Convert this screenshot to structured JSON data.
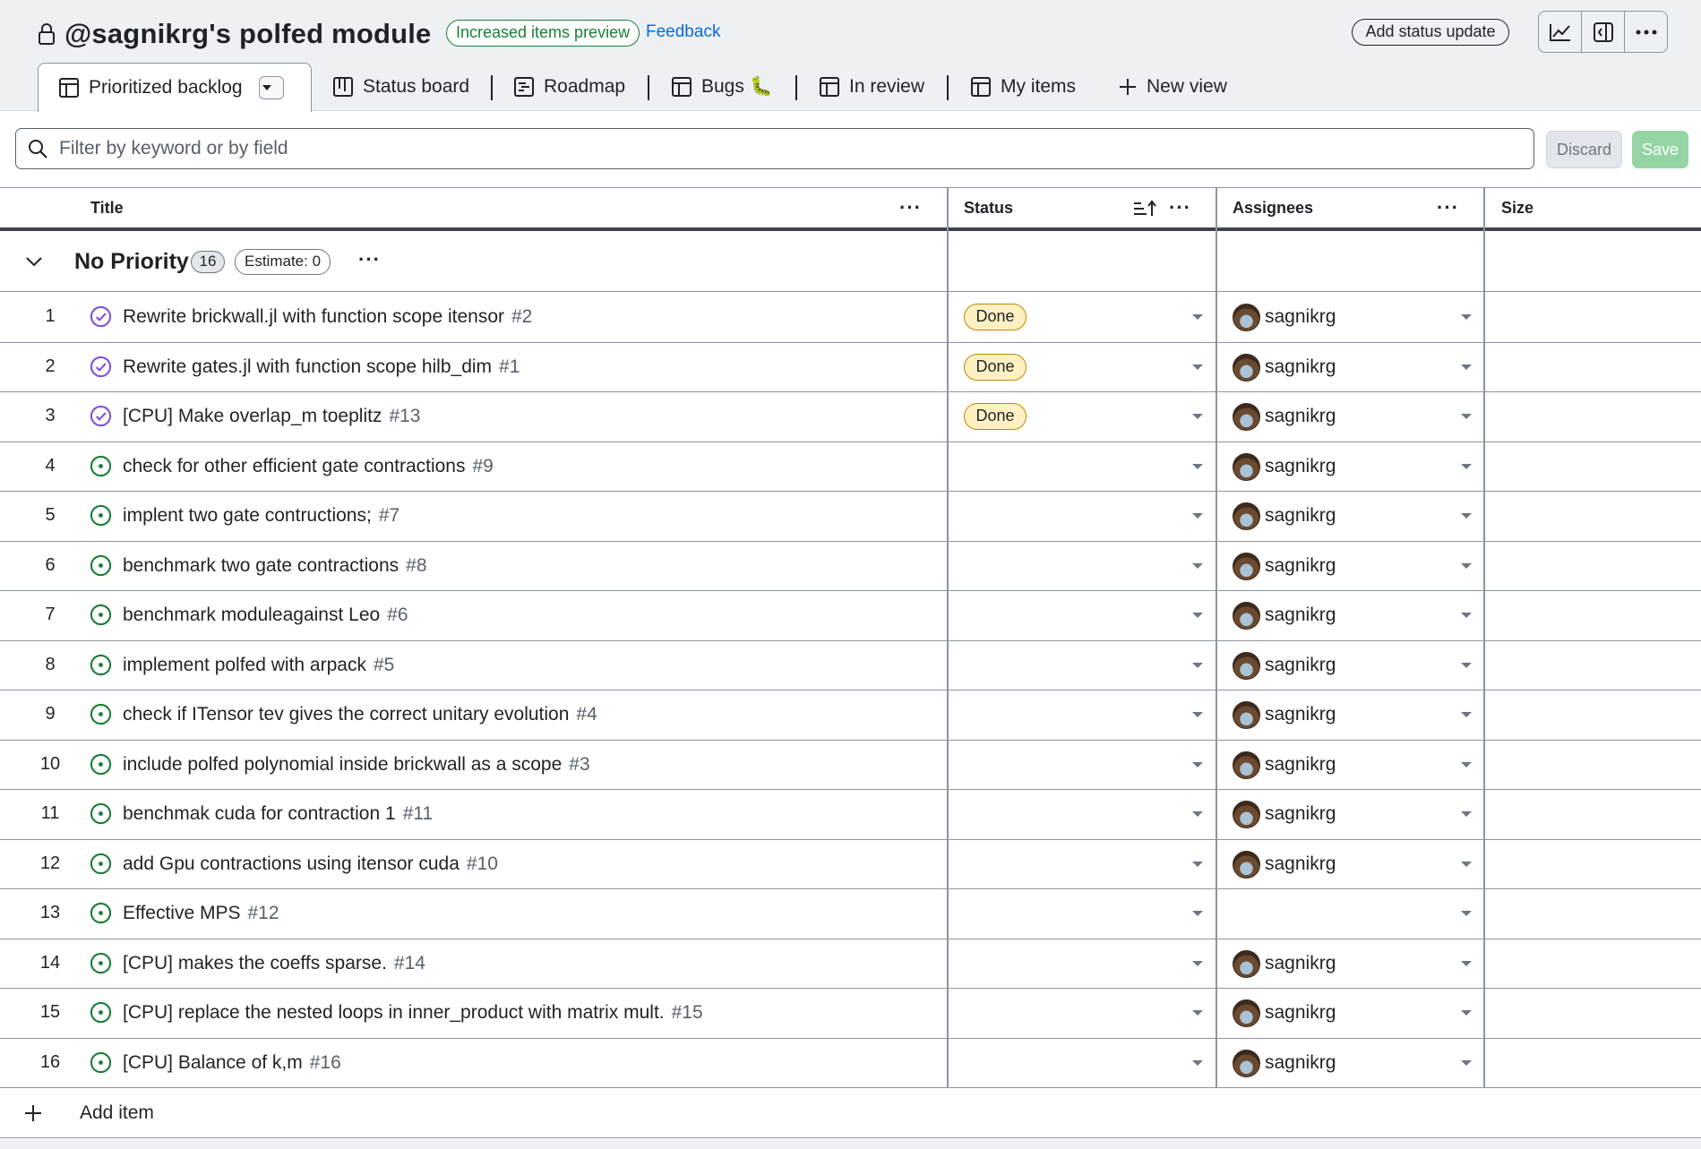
{
  "header": {
    "title": "@sagnikrg's polfed module",
    "preview_badge": "Increased items preview",
    "feedback": "Feedback",
    "status_update_button": "Add status update"
  },
  "tabs": [
    {
      "label": "Prioritized backlog",
      "icon": "table-icon",
      "active": true
    },
    {
      "label": "Status board",
      "icon": "board-icon"
    },
    {
      "label": "Roadmap",
      "icon": "roadmap-icon"
    },
    {
      "label": "Bugs 🐛",
      "icon": "table-icon"
    },
    {
      "label": "In review",
      "icon": "table-icon"
    },
    {
      "label": "My items",
      "icon": "table-icon"
    },
    {
      "label": "New view",
      "icon": "plus-icon"
    }
  ],
  "filter": {
    "placeholder": "Filter by keyword or by field",
    "discard": "Discard",
    "save": "Save"
  },
  "columns": {
    "title": "Title",
    "status": "Status",
    "assignees": "Assignees",
    "size": "Size"
  },
  "group": {
    "name": "No Priority",
    "count": "16",
    "estimate": "Estimate: 0"
  },
  "rows": [
    {
      "num": "1",
      "title": "Rewrite brickwall.jl with function scope itensor",
      "ref": "#2",
      "state": "closed",
      "status": "Done",
      "assignee": "sagnikrg"
    },
    {
      "num": "2",
      "title": "Rewrite gates.jl with function scope hilb_dim",
      "ref": "#1",
      "state": "closed",
      "status": "Done",
      "assignee": "sagnikrg"
    },
    {
      "num": "3",
      "title": "[CPU] Make overlap_m toeplitz",
      "ref": "#13",
      "state": "closed",
      "status": "Done",
      "assignee": "sagnikrg"
    },
    {
      "num": "4",
      "title": "check for other efficient gate contractions",
      "ref": "#9",
      "state": "open",
      "status": "",
      "assignee": "sagnikrg"
    },
    {
      "num": "5",
      "title": "implent two gate contructions;",
      "ref": "#7",
      "state": "open",
      "status": "",
      "assignee": "sagnikrg"
    },
    {
      "num": "6",
      "title": "benchmark two gate contractions",
      "ref": "#8",
      "state": "open",
      "status": "",
      "assignee": "sagnikrg"
    },
    {
      "num": "7",
      "title": "benchmark moduleagainst Leo",
      "ref": "#6",
      "state": "open",
      "status": "",
      "assignee": "sagnikrg"
    },
    {
      "num": "8",
      "title": "implement polfed with arpack",
      "ref": "#5",
      "state": "open",
      "status": "",
      "assignee": "sagnikrg"
    },
    {
      "num": "9",
      "title": "check if ITensor tev gives the correct unitary evolution",
      "ref": "#4",
      "state": "open",
      "status": "",
      "assignee": "sagnikrg"
    },
    {
      "num": "10",
      "title": "include polfed polynomial inside brickwall as a scope",
      "ref": "#3",
      "state": "open",
      "status": "",
      "assignee": "sagnikrg"
    },
    {
      "num": "11",
      "title": "benchmak cuda for contraction 1",
      "ref": "#11",
      "state": "open",
      "status": "",
      "assignee": "sagnikrg"
    },
    {
      "num": "12",
      "title": "add Gpu contractions using itensor cuda",
      "ref": "#10",
      "state": "open",
      "status": "",
      "assignee": "sagnikrg"
    },
    {
      "num": "13",
      "title": "Effective MPS",
      "ref": "#12",
      "state": "open",
      "status": "",
      "assignee": ""
    },
    {
      "num": "14",
      "title": "[CPU] makes the coeffs sparse.",
      "ref": "#14",
      "state": "open",
      "status": "",
      "assignee": "sagnikrg"
    },
    {
      "num": "15",
      "title": "[CPU] replace the nested loops in inner_product with matrix mult.",
      "ref": "#15",
      "state": "open",
      "status": "",
      "assignee": "sagnikrg"
    },
    {
      "num": "16",
      "title": "[CPU] Balance of k,m",
      "ref": "#16",
      "state": "open",
      "status": "",
      "assignee": "sagnikrg"
    }
  ],
  "add_item": "Add item",
  "colors": {
    "header_bg": "#eef1f4",
    "closed_purple": "#8250df",
    "open_green": "#1a7f37",
    "done_bg": "#fff1c2",
    "done_border": "#bf8700",
    "link_blue": "#0969da"
  }
}
